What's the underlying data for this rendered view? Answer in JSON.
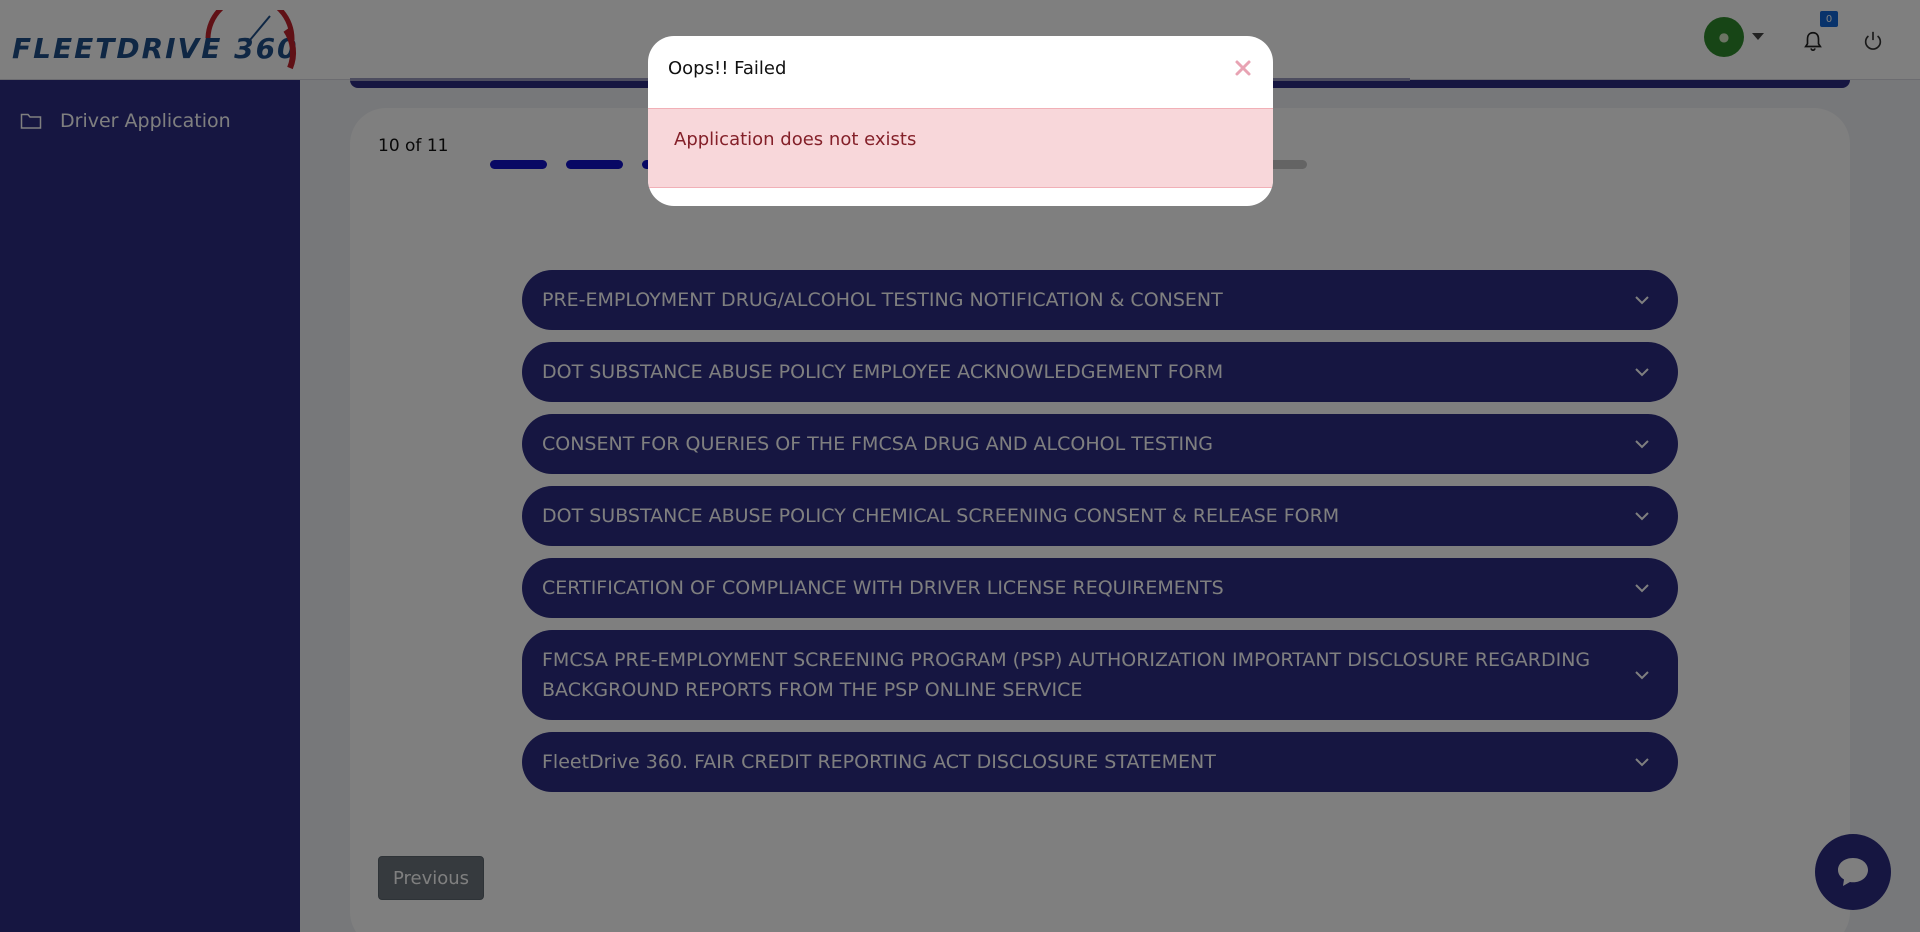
{
  "app": {
    "brand": "FLEETDRIVE 360"
  },
  "header": {
    "notification_count": "0",
    "avatar_icon": "user-avatar-icon",
    "bell_icon": "bell-icon",
    "power_icon": "power-icon"
  },
  "sidebar": {
    "items": [
      {
        "label": "Driver Application",
        "icon": "folder-icon"
      }
    ]
  },
  "main": {
    "step_text": "10 of 11",
    "progress": {
      "total": 11,
      "completed": 10
    },
    "accordions": [
      {
        "title": "PRE-EMPLOYMENT DRUG/ALCOHOL TESTING NOTIFICATION & CONSENT"
      },
      {
        "title": "DOT SUBSTANCE ABUSE POLICY EMPLOYEE ACKNOWLEDGEMENT FORM"
      },
      {
        "title": "CONSENT FOR QUERIES OF THE FMCSA DRUG AND ALCOHOL TESTING"
      },
      {
        "title": "DOT SUBSTANCE ABUSE POLICY CHEMICAL SCREENING CONSENT & RELEASE FORM"
      },
      {
        "title": "CERTIFICATION OF COMPLIANCE WITH DRIVER LICENSE REQUIREMENTS"
      },
      {
        "title": "FMCSA PRE-EMPLOYMENT SCREENING PROGRAM (PSP) AUTHORIZATION IMPORTANT DISCLOSURE REGARDING BACKGROUND REPORTS FROM THE PSP ONLINE SERVICE"
      },
      {
        "title": "FleetDrive 360. FAIR CREDIT REPORTING ACT DISCLOSURE STATEMENT"
      }
    ],
    "previous_label": "Previous"
  },
  "modal": {
    "title": "Oops!! Failed",
    "message": "Application does not exists",
    "close_icon": "close-icon"
  },
  "colors": {
    "primary": "#2c2c82",
    "progress_active": "#1010c8",
    "alert_bg": "#f8d7da",
    "alert_text": "#842029"
  }
}
